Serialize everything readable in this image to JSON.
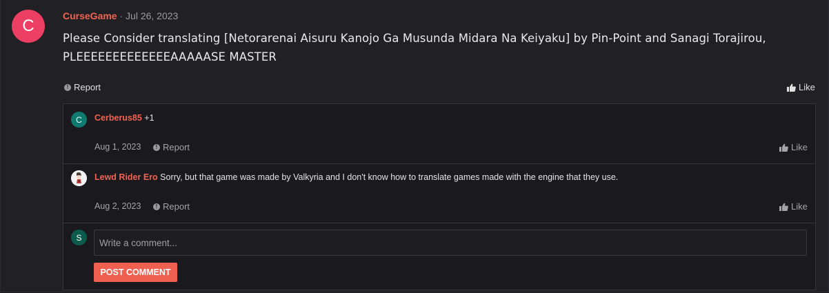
{
  "post": {
    "avatar_letter": "C",
    "author": "CurseGame",
    "separator": "·",
    "date": "Jul 26, 2023",
    "text_line1": "Please Consider translating [Netorarenai Aisuru Kanojo Ga Musunda Midara Na Keiyaku] by Pin-Point and Sanagi Torajirou,",
    "text_line2": "PLEEEEEEEEEEEEEAAAAASE MASTER",
    "report_label": "Report",
    "like_label": "Like"
  },
  "replies": [
    {
      "avatar_letter": "C",
      "avatar_color": "#0f7a6f",
      "author": "Cerberus85",
      "text": "+1",
      "date": "Aug 1, 2023",
      "report_label": "Report",
      "like_label": "Like"
    },
    {
      "avatar_letter": "",
      "avatar_color": "#f2f2f2",
      "author": "Lewd Rider Ero",
      "text": "Sorry, but that game was made by Valkyria and I don't know how to translate games made with the engine that they use.",
      "date": "Aug 2, 2023",
      "report_label": "Report",
      "like_label": "Like"
    }
  ],
  "composer": {
    "avatar_letter": "S",
    "avatar_color": "#0c5c4e",
    "placeholder": "Write a comment...",
    "submit_label": "POST COMMENT"
  },
  "colors": {
    "accent": "#f06050",
    "author": "#f16350",
    "main_avatar": "#ec3f63"
  }
}
